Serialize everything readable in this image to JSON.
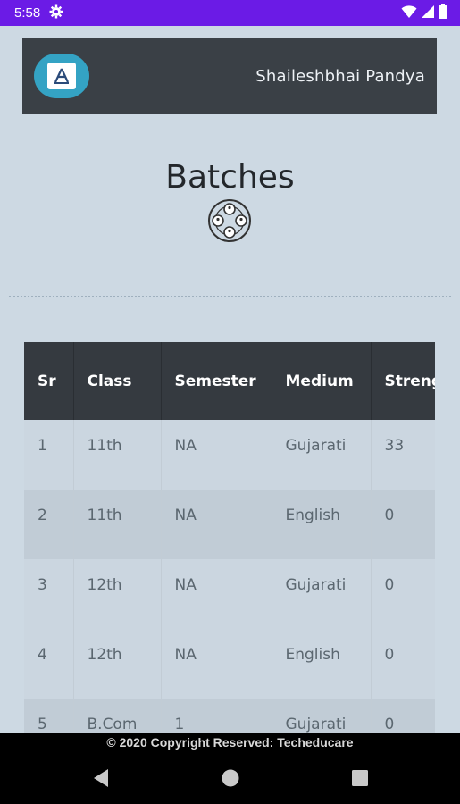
{
  "status_bar": {
    "time": "5:58",
    "icons": [
      "gear-icon",
      "wifi-icon",
      "signal-icon",
      "battery-icon"
    ]
  },
  "header": {
    "logo_icon": "app-logo",
    "user_name": "Shaileshbhai Pandya",
    "background": "#3a4046",
    "logo_color": "#34a3c4"
  },
  "page": {
    "title": "Batches",
    "title_icon": "batches-icon"
  },
  "table": {
    "columns": [
      "Sr",
      "Class",
      "Semester",
      "Medium",
      "Strength"
    ],
    "rows": [
      [
        "1",
        "11th",
        "NA",
        "Gujarati",
        "33"
      ],
      [
        "2",
        "11th",
        "NA",
        "English",
        "0"
      ],
      [
        "3",
        "12th",
        "NA",
        "Gujarati",
        "0"
      ],
      [
        "4",
        "12th",
        "NA",
        "English",
        "0"
      ],
      [
        "5",
        "B.Com",
        "1",
        "Gujarati",
        "0"
      ]
    ]
  },
  "footer": {
    "copyright": "© 2020 Copyright Reserved: Techeducare"
  },
  "nav": {
    "back_icon": "back-icon",
    "home_icon": "home-icon",
    "recents_icon": "recents-icon"
  },
  "colors": {
    "status_bar": "#6b1be6",
    "background": "#cdd9e3",
    "table_header": "#353a40"
  }
}
